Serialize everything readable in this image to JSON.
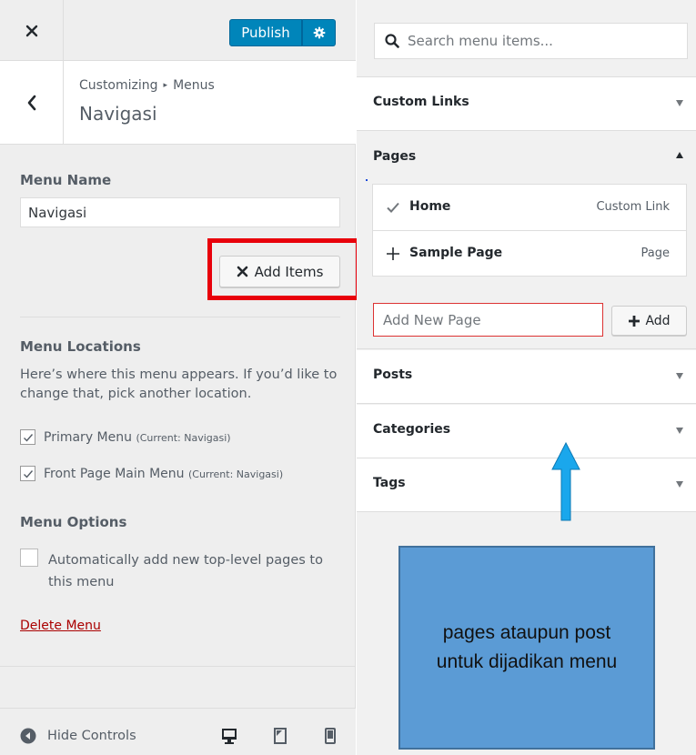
{
  "header": {
    "publish_label": "Publish"
  },
  "section": {
    "breadcrumb_root": "Customizing",
    "breadcrumb_sep": "▸",
    "breadcrumb_child": "Menus",
    "title": "Navigasi"
  },
  "menu": {
    "name_label": "Menu Name",
    "name_value": "Navigasi",
    "add_items_label": "Add Items",
    "locations_title": "Menu Locations",
    "locations_desc": "Here’s where this menu appears. If you’d like to change that, pick another location.",
    "locations": [
      {
        "label": "Primary Menu",
        "current": "(Current: Navigasi)",
        "checked": true
      },
      {
        "label": "Front Page Main Menu",
        "current": "(Current: Navigasi)",
        "checked": true
      }
    ],
    "options_title": "Menu Options",
    "auto_add_label": "Automatically add new top-level pages to this menu",
    "auto_add_checked": false,
    "delete_label": "Delete Menu"
  },
  "footer": {
    "hide_controls_label": "Hide Controls",
    "devices": [
      "desktop-icon",
      "tablet-icon",
      "mobile-icon"
    ]
  },
  "available": {
    "search_placeholder": "Search menu items...",
    "sections": {
      "custom_links": "Custom Links",
      "pages": "Pages",
      "posts": "Posts",
      "categories": "Categories",
      "tags": "Tags"
    },
    "pages_items": [
      {
        "title": "Home",
        "kind": "Custom Link",
        "state": "added"
      },
      {
        "title": "Sample Page",
        "kind": "Page",
        "state": "add"
      }
    ],
    "add_new_placeholder": "Add New Page",
    "add_label": "Add"
  },
  "callout": {
    "text": "pages ataupun post untuk dijadikan menu"
  },
  "colors": {
    "primary": "#0085ba",
    "highlight": "#e8000b",
    "callout": "#5b9bd5",
    "arrow": "#1aa7ec",
    "delete": "#aa0000"
  }
}
